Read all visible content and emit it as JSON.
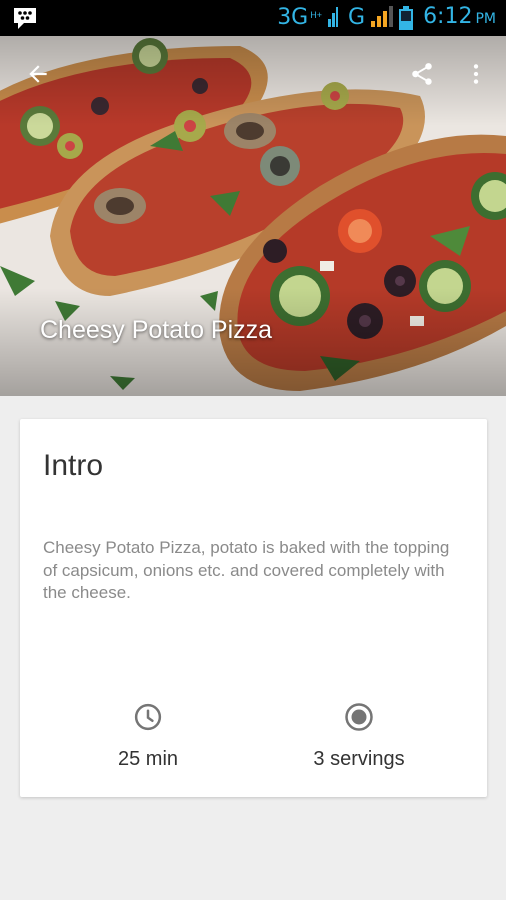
{
  "status_bar": {
    "network_primary": "3G",
    "network_sub": "H+",
    "network_secondary": "G",
    "time": "6:12",
    "ampm": "PM"
  },
  "recipe": {
    "title": "Cheesy Potato Pizza"
  },
  "intro": {
    "heading": "Intro",
    "description": "Cheesy Potato Pizza, potato is baked with the topping of capsicum, onions etc. and covered completely with the cheese.",
    "duration": "25 min",
    "servings": "3 servings"
  },
  "icons": {
    "back": "arrow-back-icon",
    "share": "share-icon",
    "more": "more-vert-icon",
    "clock": "clock-icon",
    "servings": "radio-target-icon",
    "bbm": "bbm-chat-icon",
    "battery": "battery-icon",
    "signal": "signal-icon"
  },
  "colors": {
    "status_accent": "#33b5e5",
    "card_bg": "#ffffff",
    "page_bg": "#eeeeee",
    "body_text": "#333333",
    "secondary_text": "#8a8a8a"
  }
}
